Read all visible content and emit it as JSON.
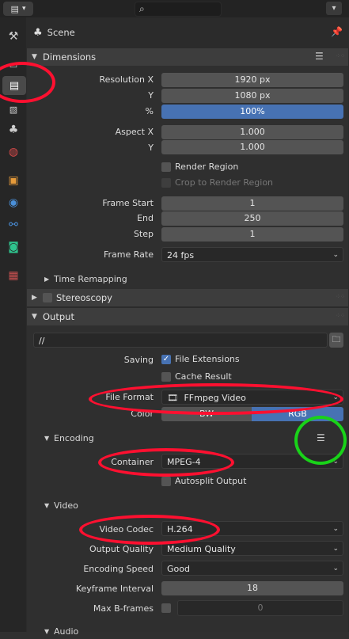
{
  "topbar": {
    "search_icon": "search-icon",
    "editor_icon": "editor-type-icon"
  },
  "tabs": [
    {
      "name": "tool",
      "icon": "wrench-icon",
      "glyph": "⚒",
      "color": "#cfcfcf"
    },
    {
      "name": "render",
      "icon": "camera-back-icon",
      "glyph": "📷",
      "color": "#cfcfcf"
    },
    {
      "name": "output",
      "icon": "printer-icon",
      "glyph": "🖶",
      "color": "#ffffff",
      "active": true
    },
    {
      "name": "view-layer",
      "icon": "image-stack-icon",
      "glyph": "🖼",
      "color": "#cfcfcf"
    },
    {
      "name": "scene",
      "icon": "scene-icon",
      "glyph": "♣",
      "color": "#cfcfcf"
    },
    {
      "name": "world",
      "icon": "world-icon",
      "glyph": "🌐",
      "color": "#d84a4a"
    },
    {
      "name": "object",
      "icon": "object-icon",
      "glyph": "▣",
      "color": "#e59a3a"
    },
    {
      "name": "physics",
      "icon": "physics-icon",
      "glyph": "◉",
      "color": "#4a8fd8"
    },
    {
      "name": "constraints",
      "icon": "constraint-icon",
      "glyph": "⚯",
      "color": "#4a8fd8"
    },
    {
      "name": "data",
      "icon": "camera-data-icon",
      "glyph": "🎥",
      "color": "#2fc48e"
    },
    {
      "name": "texture",
      "icon": "checker-icon",
      "glyph": "▦",
      "color": "#c95050"
    }
  ],
  "scene": {
    "label": "Scene"
  },
  "dimensions": {
    "title": "Dimensions",
    "resolution_x_label": "Resolution X",
    "resolution_x": "1920 px",
    "resolution_y_label": "Y",
    "resolution_y": "1080 px",
    "percent_label": "%",
    "percent": "100%",
    "aspect_x_label": "Aspect X",
    "aspect_x": "1.000",
    "aspect_y_label": "Y",
    "aspect_y": "1.000",
    "render_region": "Render Region",
    "crop_region": "Crop to Render Region",
    "frame_start_label": "Frame Start",
    "frame_start": "1",
    "end_label": "End",
    "end": "250",
    "step_label": "Step",
    "step": "1",
    "frame_rate_label": "Frame Rate",
    "frame_rate": "24 fps",
    "time_remapping": "Time Remapping"
  },
  "stereoscopy": {
    "title": "Stereoscopy"
  },
  "output": {
    "title": "Output",
    "path": "//",
    "saving_label": "Saving",
    "file_extensions": "File Extensions",
    "cache_result": "Cache Result",
    "file_format_label": "File Format",
    "file_format": "FFmpeg Video",
    "color_label": "Color",
    "color_bw": "BW",
    "color_rgb": "RGB"
  },
  "encoding": {
    "title": "Encoding",
    "container_label": "Container",
    "container": "MPEG-4",
    "autosplit": "Autosplit Output"
  },
  "video": {
    "title": "Video",
    "codec_label": "Video Codec",
    "codec": "H.264",
    "quality_label": "Output Quality",
    "quality": "Medium Quality",
    "speed_label": "Encoding Speed",
    "speed": "Good",
    "keyframe_label": "Keyframe Interval",
    "keyframe": "18",
    "bframes_label": "Max B-frames",
    "bframes": "0"
  },
  "audio": {
    "title": "Audio"
  },
  "annotation_colors": {
    "red": "#ff1030",
    "green": "#19d219"
  }
}
